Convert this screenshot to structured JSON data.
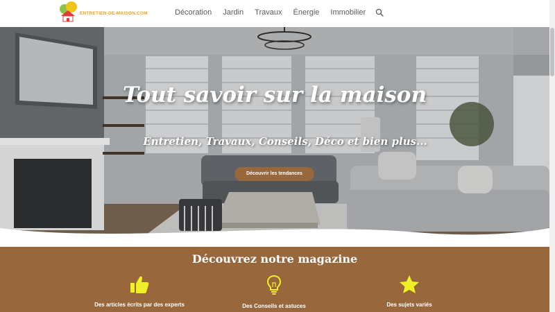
{
  "header": {
    "logo_text": "ENTRETIEN-DE-MAISON.COM",
    "nav": [
      {
        "label": "Décoration"
      },
      {
        "label": "Jardin"
      },
      {
        "label": "Travaux"
      },
      {
        "label": "Énergie"
      },
      {
        "label": "Immobilier"
      }
    ],
    "search_icon": "search-icon"
  },
  "hero": {
    "title": "Tout savoir sur la maison",
    "subtitle": "Entretien, Travaux, Conseils, Déco et bien plus...",
    "cta_label": "Découvrir les tendances"
  },
  "magazine": {
    "title": "Découvrez notre magazine",
    "features": [
      {
        "icon": "thumbs-up-icon",
        "label": "Des articles écrits par des experts"
      },
      {
        "icon": "lightbulb-icon",
        "label": "Des Conseils et astuces"
      },
      {
        "icon": "star-icon",
        "label": "Des sujets variés"
      }
    ]
  },
  "colors": {
    "brand_brown": "#98673c",
    "icon_yellow": "#eff126",
    "logo_orange": "#e7a21e",
    "nav_text": "#5a5a5a"
  }
}
